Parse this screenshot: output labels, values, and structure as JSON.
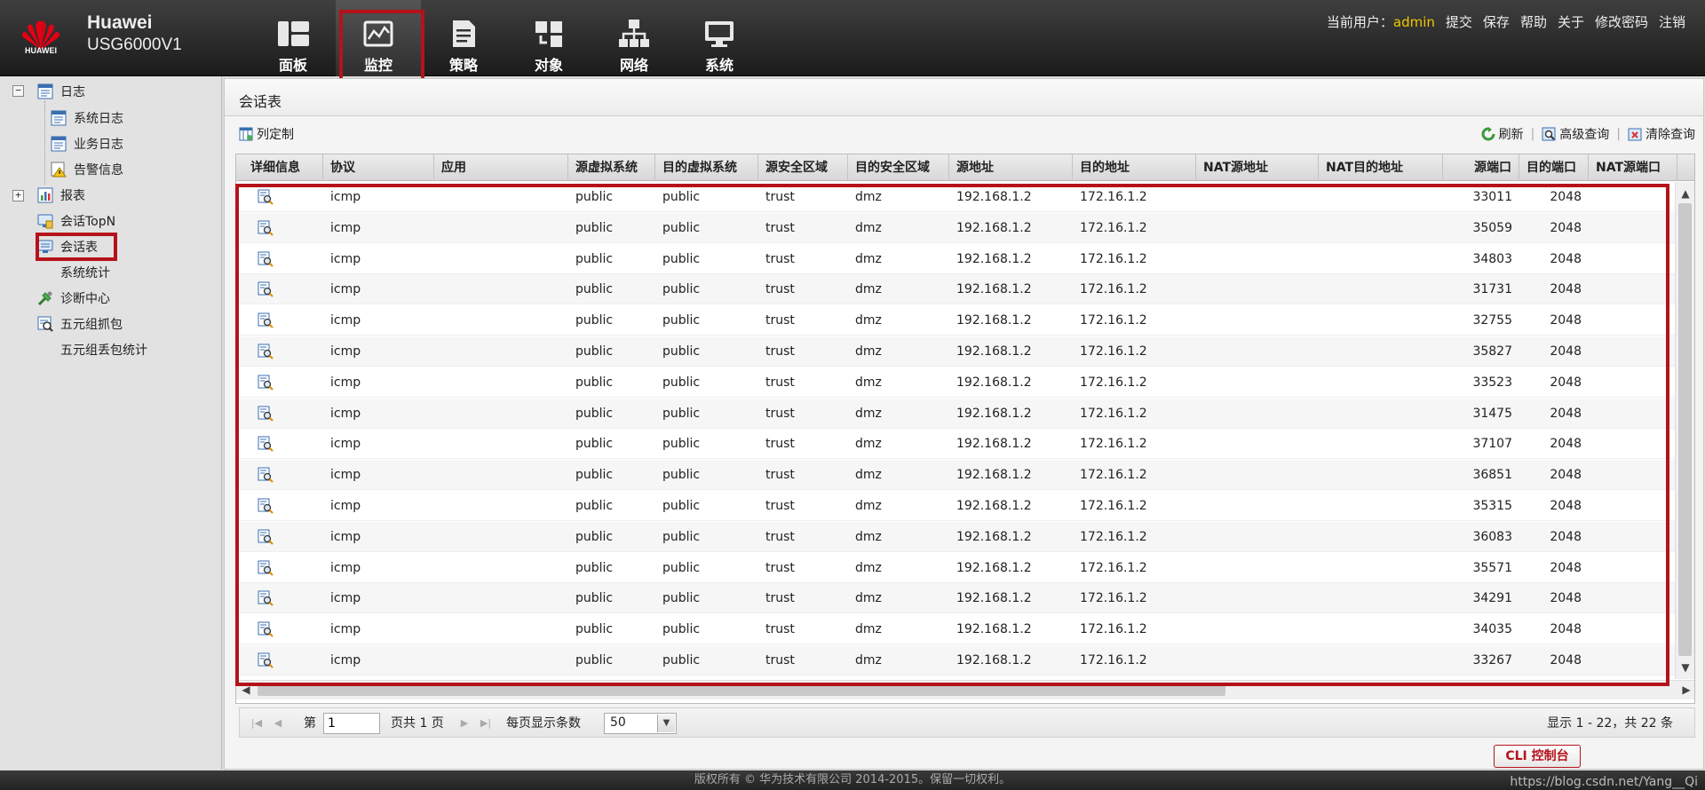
{
  "header": {
    "logo_text": "HUAWEI",
    "brand_line1": "Huawei",
    "brand_line2": "USG6000V1",
    "nav": [
      {
        "label": "面板",
        "icon": "dashboard-icon"
      },
      {
        "label": "监控",
        "icon": "monitor-icon",
        "active": true
      },
      {
        "label": "策略",
        "icon": "policy-icon"
      },
      {
        "label": "对象",
        "icon": "object-icon"
      },
      {
        "label": "网络",
        "icon": "network-icon"
      },
      {
        "label": "系统",
        "icon": "system-icon"
      }
    ],
    "user_label": "当前用户：",
    "username": "admin",
    "links": [
      "提交",
      "保存",
      "帮助",
      "关于",
      "修改密码",
      "注销"
    ]
  },
  "sidebar": {
    "items": [
      {
        "label": "日志",
        "icon": "log-icon"
      },
      {
        "label": "系统日志",
        "icon": "system-log-icon"
      },
      {
        "label": "业务日志",
        "icon": "business-log-icon"
      },
      {
        "label": "告警信息",
        "icon": "alarm-icon"
      },
      {
        "label": "报表",
        "icon": "report-icon"
      },
      {
        "label": "会话TopN",
        "icon": "session-topn-icon"
      },
      {
        "label": "会话表",
        "icon": "session-table-icon",
        "selected": true
      },
      {
        "label": "系统统计",
        "icon": ""
      },
      {
        "label": "诊断中心",
        "icon": "diagnosis-icon"
      },
      {
        "label": "五元组抓包",
        "icon": "capture-icon"
      },
      {
        "label": "五元组丢包统计",
        "icon": ""
      }
    ]
  },
  "panel": {
    "title": "会话表",
    "toolbar": {
      "column_custom": "列定制",
      "refresh": "刷新",
      "advanced_query": "高级查询",
      "clear_query": "清除查询"
    }
  },
  "table": {
    "columns": [
      "详细信息",
      "协议",
      "应用",
      "源虚拟系统",
      "目的虚拟系统",
      "源安全区域",
      "目的安全区域",
      "源地址",
      "目的地址",
      "NAT源地址",
      "NAT目的地址",
      "源端口",
      "目的端口",
      "NAT源端口"
    ],
    "rows": [
      [
        "icmp",
        "",
        "public",
        "public",
        "trust",
        "dmz",
        "192.168.1.2",
        "172.16.1.2",
        "",
        "",
        "33011",
        "2048",
        ""
      ],
      [
        "icmp",
        "",
        "public",
        "public",
        "trust",
        "dmz",
        "192.168.1.2",
        "172.16.1.2",
        "",
        "",
        "35059",
        "2048",
        ""
      ],
      [
        "icmp",
        "",
        "public",
        "public",
        "trust",
        "dmz",
        "192.168.1.2",
        "172.16.1.2",
        "",
        "",
        "34803",
        "2048",
        ""
      ],
      [
        "icmp",
        "",
        "public",
        "public",
        "trust",
        "dmz",
        "192.168.1.2",
        "172.16.1.2",
        "",
        "",
        "31731",
        "2048",
        ""
      ],
      [
        "icmp",
        "",
        "public",
        "public",
        "trust",
        "dmz",
        "192.168.1.2",
        "172.16.1.2",
        "",
        "",
        "32755",
        "2048",
        ""
      ],
      [
        "icmp",
        "",
        "public",
        "public",
        "trust",
        "dmz",
        "192.168.1.2",
        "172.16.1.2",
        "",
        "",
        "35827",
        "2048",
        ""
      ],
      [
        "icmp",
        "",
        "public",
        "public",
        "trust",
        "dmz",
        "192.168.1.2",
        "172.16.1.2",
        "",
        "",
        "33523",
        "2048",
        ""
      ],
      [
        "icmp",
        "",
        "public",
        "public",
        "trust",
        "dmz",
        "192.168.1.2",
        "172.16.1.2",
        "",
        "",
        "31475",
        "2048",
        ""
      ],
      [
        "icmp",
        "",
        "public",
        "public",
        "trust",
        "dmz",
        "192.168.1.2",
        "172.16.1.2",
        "",
        "",
        "37107",
        "2048",
        ""
      ],
      [
        "icmp",
        "",
        "public",
        "public",
        "trust",
        "dmz",
        "192.168.1.2",
        "172.16.1.2",
        "",
        "",
        "36851",
        "2048",
        ""
      ],
      [
        "icmp",
        "",
        "public",
        "public",
        "trust",
        "dmz",
        "192.168.1.2",
        "172.16.1.2",
        "",
        "",
        "35315",
        "2048",
        ""
      ],
      [
        "icmp",
        "",
        "public",
        "public",
        "trust",
        "dmz",
        "192.168.1.2",
        "172.16.1.2",
        "",
        "",
        "36083",
        "2048",
        ""
      ],
      [
        "icmp",
        "",
        "public",
        "public",
        "trust",
        "dmz",
        "192.168.1.2",
        "172.16.1.2",
        "",
        "",
        "35571",
        "2048",
        ""
      ],
      [
        "icmp",
        "",
        "public",
        "public",
        "trust",
        "dmz",
        "192.168.1.2",
        "172.16.1.2",
        "",
        "",
        "34291",
        "2048",
        ""
      ],
      [
        "icmp",
        "",
        "public",
        "public",
        "trust",
        "dmz",
        "192.168.1.2",
        "172.16.1.2",
        "",
        "",
        "34035",
        "2048",
        ""
      ],
      [
        "icmp",
        "",
        "public",
        "public",
        "trust",
        "dmz",
        "192.168.1.2",
        "172.16.1.2",
        "",
        "",
        "33267",
        "2048",
        ""
      ]
    ]
  },
  "pager": {
    "page_prefix": "第",
    "page_value": "1",
    "page_suffix": "页共 1 页",
    "per_page_label": "每页显示条数",
    "per_page_value": "50",
    "summary": "显示 1 - 22，共 22 条"
  },
  "cli_button": "CLI 控制台",
  "footer": {
    "copyright": "版权所有 © 华为技术有限公司 2014-2015。保留一切权利。",
    "watermark": "https://blog.csdn.net/Yang__Qi"
  },
  "colors": {
    "accent_red": "#b5121b",
    "username": "#f0c800"
  }
}
